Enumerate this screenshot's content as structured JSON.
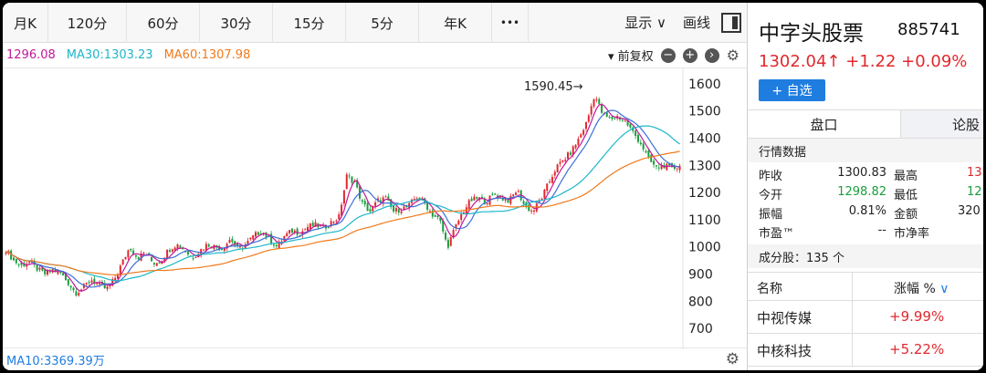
{
  "toolbar": {
    "periods": [
      "月K",
      "120分",
      "60分",
      "30分",
      "15分",
      "5分",
      "年K"
    ],
    "more": "•••",
    "display_label": "显示",
    "line_label": "画线"
  },
  "ma_bar": {
    "ma_values": [
      {
        "text": "1296.08",
        "color": "#c2179a"
      },
      {
        "text": "MA30:1303.23",
        "color": "#1cb7c9"
      },
      {
        "text": "MA60:1307.98",
        "color": "#f07a1c"
      }
    ],
    "adjust_label": "前复权"
  },
  "chart_data": {
    "type": "candlestick",
    "y_ticks": [
      "1600",
      "1500",
      "1400",
      "1300",
      "1200",
      "1100",
      "1000",
      "900",
      "800",
      "700"
    ],
    "ylim": [
      650,
      1650
    ],
    "high_annotation": "1590.45→",
    "close_series": [
      990,
      950,
      930,
      945,
      920,
      900,
      915,
      905,
      870,
      830,
      850,
      880,
      860,
      845,
      880,
      940,
      1000,
      960,
      980,
      940,
      950,
      990,
      1010,
      990,
      960,
      985,
      1010,
      1000,
      995,
      1030,
      990,
      1010,
      1040,
      1060,
      1030,
      1000,
      1040,
      1060,
      1050,
      1075,
      1080,
      1070,
      1090,
      1110,
      1260,
      1240,
      1160,
      1130,
      1170,
      1180,
      1130,
      1140,
      1150,
      1185,
      1165,
      1120,
      1100,
      1000,
      1070,
      1130,
      1170,
      1180,
      1165,
      1195,
      1180,
      1170,
      1210,
      1150,
      1130,
      1170,
      1230,
      1290,
      1320,
      1350,
      1400,
      1460,
      1560,
      1490,
      1470,
      1480,
      1460,
      1420,
      1380,
      1320,
      1290,
      1300,
      1285,
      1302
    ],
    "ma_series_names": [
      "MA5",
      "MA10",
      "MA30",
      "MA60"
    ]
  },
  "volume_bar": {
    "label": "MA10:3369.39万"
  },
  "side": {
    "title": "中字头股票",
    "code": "885741",
    "price_line": "1302.04↑ +1.22 +0.09%",
    "add_label": "+ 自选",
    "tab_active": "盘口",
    "tab_other": "论股",
    "quote_header": "行情数据",
    "quotes": [
      {
        "l1": "昨收",
        "v1": "1300.83",
        "v1_color": "#222222",
        "l2": "最高",
        "v2": "13",
        "v2_color": "#e0282e"
      },
      {
        "l1": "今开",
        "v1": "1298.82",
        "v1_color": "#1a9d3c",
        "l2": "最低",
        "v2": "12",
        "v2_color": "#1a9d3c"
      },
      {
        "l1": "振幅",
        "v1": "0.81%",
        "v1_color": "#222222",
        "l2": "金额",
        "v2": "320",
        "v2_color": "#222222"
      },
      {
        "l1": "市盈™",
        "v1": "--",
        "v1_color": "#222222",
        "l2": "市净率",
        "v2": "",
        "v2_color": "#222222"
      }
    ],
    "components_label": "成分股：135 个",
    "list_header": {
      "name": "名称",
      "change": "涨幅 %"
    },
    "rows": [
      {
        "name": "中视传媒",
        "change": "+9.99%"
      },
      {
        "name": "中核科技",
        "change": "+5.22%"
      }
    ]
  }
}
